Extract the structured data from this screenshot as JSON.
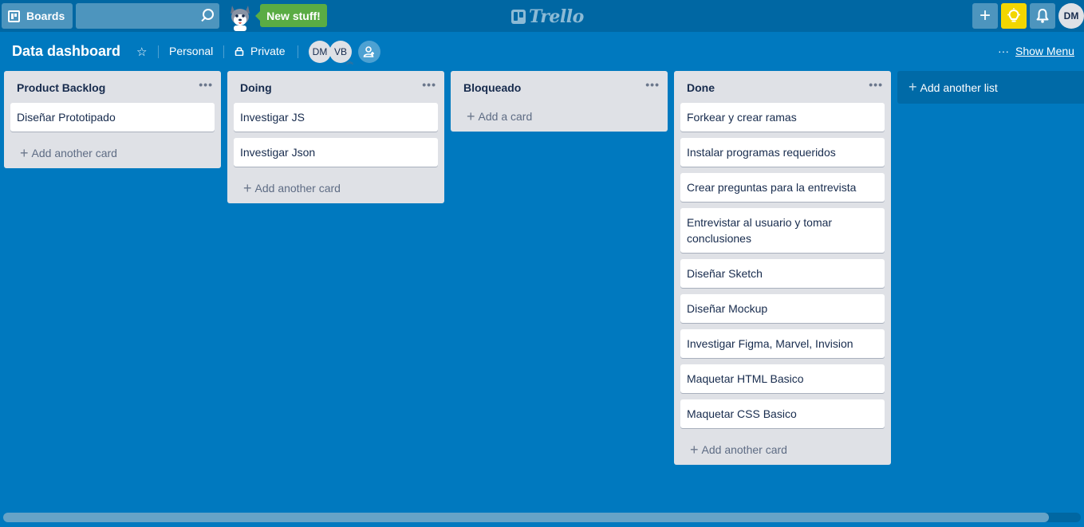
{
  "header": {
    "boards_label": "Boards",
    "new_stuff_label": "New stuff!",
    "logo_text": "Trello",
    "user_initials": "DM",
    "bulb_color": "#f2d600"
  },
  "board": {
    "title": "Data dashboard",
    "team_label": "Personal",
    "visibility_label": "Private",
    "members": [
      "DM",
      "VB"
    ],
    "show_menu_label": "Show Menu"
  },
  "lists": [
    {
      "title": "Product Backlog",
      "cards": [
        "Diseñar Prototipado"
      ],
      "add_label": "Add another card"
    },
    {
      "title": "Doing",
      "cards": [
        "Investigar JS",
        "Investigar Json"
      ],
      "add_label": "Add another card"
    },
    {
      "title": "Bloqueado",
      "cards": [],
      "add_label": "Add a card"
    },
    {
      "title": "Done",
      "cards": [
        "Forkear y crear ramas",
        "Instalar programas requeridos",
        "Crear preguntas para la entrevista",
        "Entrevistar al usuario y tomar conclusiones",
        "Diseñar Sketch",
        "Diseñar Mockup",
        "Investigar Figma, Marvel, Invision",
        "Maquetar HTML Basico",
        "Maquetar CSS Basico"
      ],
      "add_label": "Add another card"
    }
  ],
  "add_list_label": "Add another list",
  "colors": {
    "board_background": "#0079bf",
    "header_background": "#0067a3",
    "new_stuff": "#5aac44",
    "list_background": "#dfe1e6"
  }
}
